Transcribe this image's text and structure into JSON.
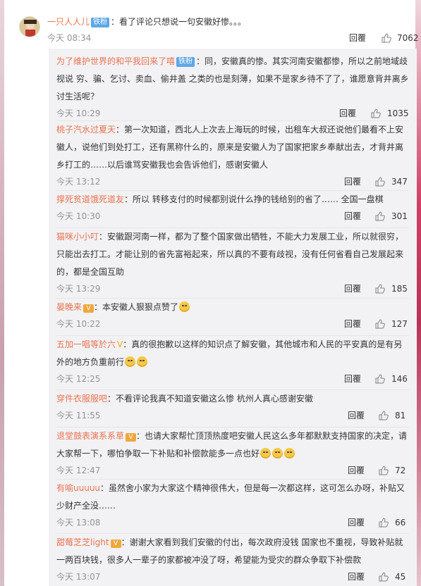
{
  "top": {
    "name": "一只人人儿",
    "badge": "铁粉",
    "text": "：看了评论只想说一句安徽好惨。。。",
    "time": "今天 08:34",
    "reply_label": "回覆",
    "likes": "7062"
  },
  "subs": [
    {
      "name": "为了维护世界的和平我回来了嘻",
      "badge": "铁粉",
      "text": "：同，安徽真的惨。其实河南安徽都惨，所以之前地域歧视说 穷、骗、乞讨、卖血、偷井盖 之类的也是刻薄，如果不是家乡待不了了，谁愿意背井离乡讨生活呢？",
      "time": "今天 10:29",
      "reply": "回覆",
      "likes": "1035"
    },
    {
      "name": "桃子汽水过夏天",
      "text": "：第一次知道，西北人上次去上海玩的时候，出租车大叔还说他们最看不上安徽人，说他们到处打工，还有黑称什么的，原来是安徽人为了国家把家乡奉献出去，才背井离乡打工的……以后谁骂安徽我也会告诉他们，感谢安徽人",
      "time": "今天 13:12",
      "reply": "回覆",
      "likes": "347"
    },
    {
      "name": "撑死贫道饿死道友",
      "text": "：所以 转移支付的时候都别说什么挣的钱给别的省了…… 全国一盘棋",
      "time": "今天 10:30",
      "reply": "回覆",
      "likes": "301"
    },
    {
      "name": "猫咪小小叮",
      "text": "：安徽跟河南一样，都为了整个国家做出牺牲，不能大力发展工业，所以就很穷，只能出去打工。才能让别的省先富裕起来，所以真的不要有歧视，没有任何省看自己发展起来的，都是全国互助",
      "time": "今天 13:29",
      "reply": "回覆",
      "likes": "185"
    },
    {
      "name": "晏晚来",
      "vip": "1",
      "text": "：本安徽人狠狠点赞了",
      "time": "今天 10:22",
      "reply": "回覆",
      "likes": "127"
    },
    {
      "name": "五加一唱等於六",
      "check": "V",
      "text": "：真的很抱歉以这样的知识点了解安徽，其他城市和人民的平安真的是有另外的地方负重前行",
      "time": "今天 12:25",
      "reply": "回覆",
      "likes": "146"
    },
    {
      "name": "穿件衣服服吧",
      "text": "：不看评论我真不知道安徽这么惨 杭州人真心感谢安徽",
      "time": "今天 11:55",
      "reply": "回覆",
      "likes": "81"
    },
    {
      "name": "退堂鼓表演系系草",
      "vip": "1",
      "text": "：也请大家帮忙顶顶热度吧安徽人民这么多年都默默支持国家的决定，请大家帮一下，哪怕争取一下补贴和补偿款能多一点也好",
      "time": "今天 12:47",
      "reply": "回覆",
      "likes": "72"
    },
    {
      "name": "有喻uuuuu",
      "text": "：虽然舍小家为大家这个精神很伟大，但是每一次都这样，这可怎么办呀，补贴又少财产全没……",
      "time": "今天 13:08",
      "reply": "回覆",
      "likes": "66"
    },
    {
      "name": "甜莓芝芝light",
      "vip": "1",
      "text": "：谢谢大家看到我们安徽的付出，每次政府没钱 国家也不重视，导致补贴就一两百块钱，很多人一辈子的家都被冲没了呀，希望能为受灾的群众争取下补偿款",
      "time": "今天 13:07",
      "reply": "回覆",
      "likes": "45"
    }
  ]
}
